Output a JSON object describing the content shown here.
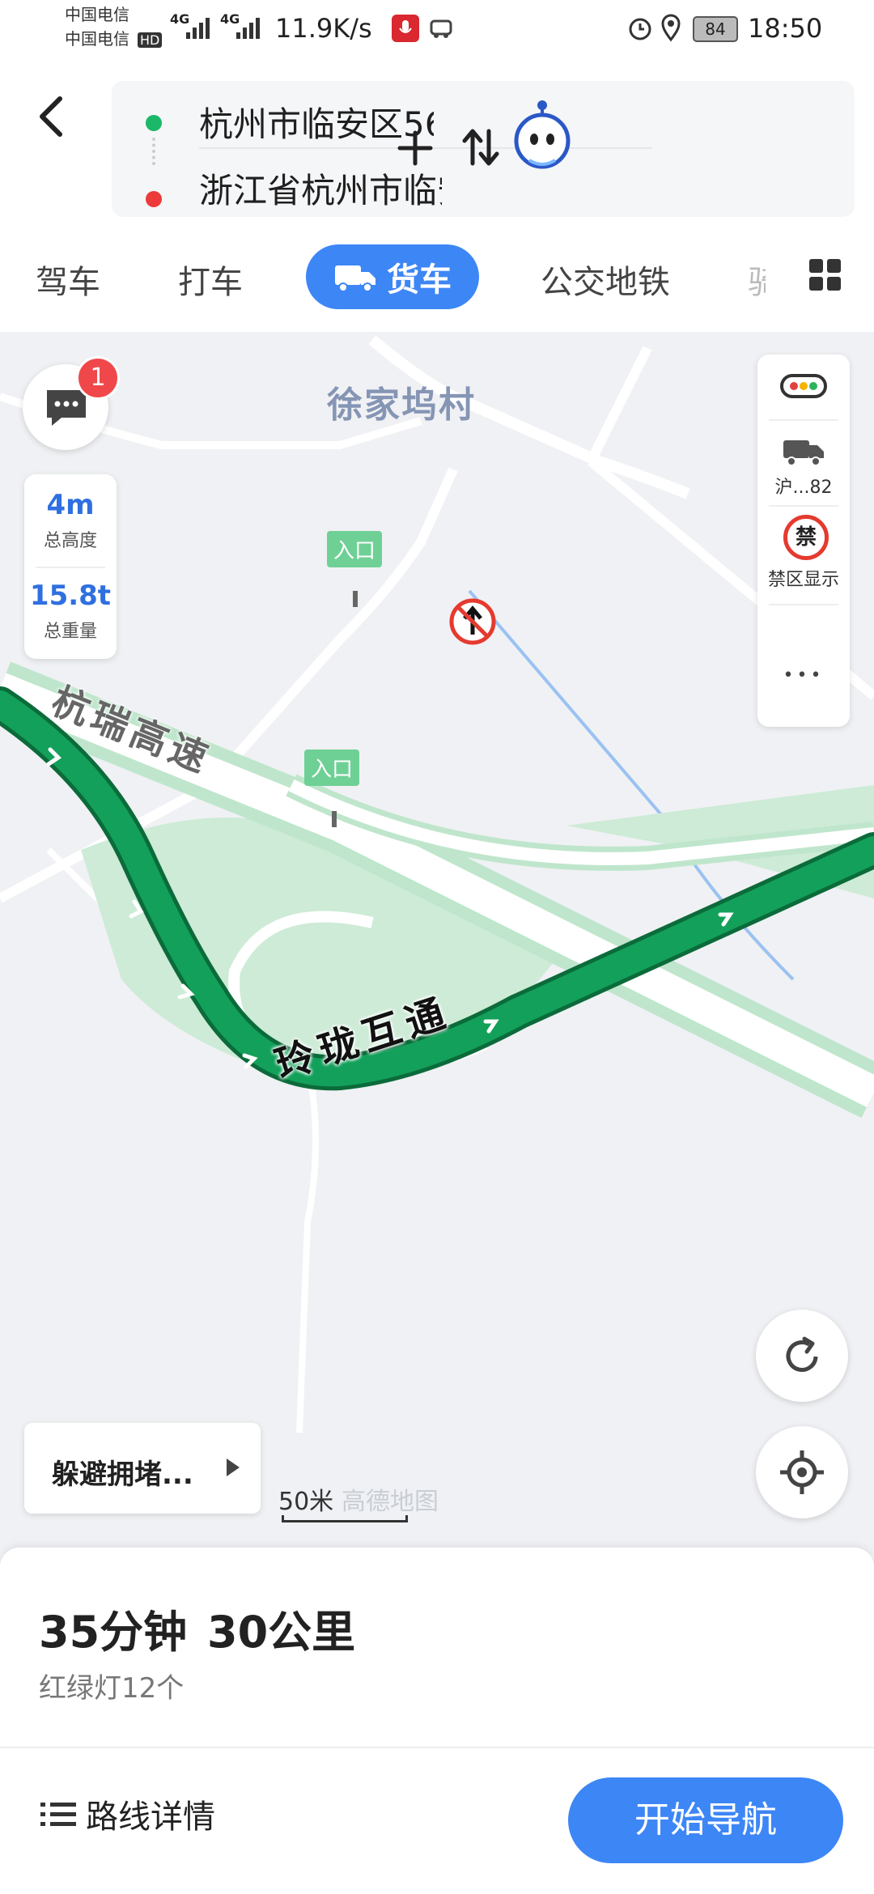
{
  "status_bar": {
    "carrier1": "中国电信",
    "carrier2": "中国电信",
    "hd": "HD",
    "net1": "4G",
    "net2": "4G",
    "speed": "11.9K/s",
    "battery": "84",
    "time": "18:50"
  },
  "route": {
    "origin": "杭州市临安区56...",
    "destination": "浙江省杭州市临安..."
  },
  "tabs": [
    "驾车",
    "打车",
    "货车",
    "公交地铁",
    "骑"
  ],
  "active_tab_index": 2,
  "map": {
    "message_badge": "1",
    "truck_height": "4m",
    "truck_height_label": "总高度",
    "truck_weight": "15.8t",
    "truck_weight_label": "总重量",
    "village": "徐家坞村",
    "highway": "杭瑞高速",
    "interchange": "玲珑互通",
    "entrance1": "入口",
    "entrance2": "入口",
    "plate_label": "沪...82",
    "restricted_icon": "禁",
    "restricted_label": "禁区显示",
    "more": "•••",
    "avoid_congestion": "躲避拥堵...",
    "scale": "50米",
    "map_brand": "高德地图"
  },
  "summary": {
    "duration": "35分钟",
    "distance": "30公里",
    "traffic_lights": "红绿灯12个"
  },
  "actions": {
    "route_details": "路线详情",
    "start_navigation": "开始导航"
  },
  "colors": {
    "primary_blue": "#3d86f6",
    "route_green": "#13a05a",
    "origin_dot": "#1bb86a",
    "dest_dot": "#ec3a3a"
  }
}
